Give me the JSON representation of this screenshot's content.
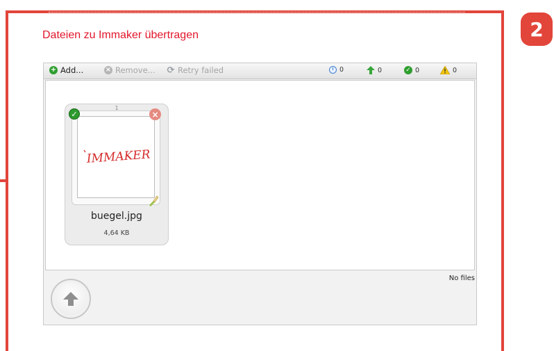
{
  "page": {
    "title": "Dateien zu Immaker übertragen",
    "step_number": "2"
  },
  "toolbar": {
    "add_label": "Add...",
    "remove_label": "Remove...",
    "retry_label": "Retry failed",
    "counters": {
      "queued": "0",
      "uploading": "0",
      "done": "0",
      "warnings": "0"
    }
  },
  "files": [
    {
      "index": "1",
      "name": "buegel.jpg",
      "size": "4,64 KB",
      "thumbnail_text": "IMMAKER"
    }
  ],
  "status": {
    "text": "No files"
  },
  "colors": {
    "accent_red": "#e2453a",
    "title_red": "#e2162a",
    "ok_green": "#2f9e2f"
  },
  "icons": [
    "add-icon",
    "remove-icon",
    "retry-icon",
    "clock-icon",
    "upload-arrow-icon",
    "check-icon",
    "warning-icon",
    "close-icon",
    "brush-icon"
  ]
}
